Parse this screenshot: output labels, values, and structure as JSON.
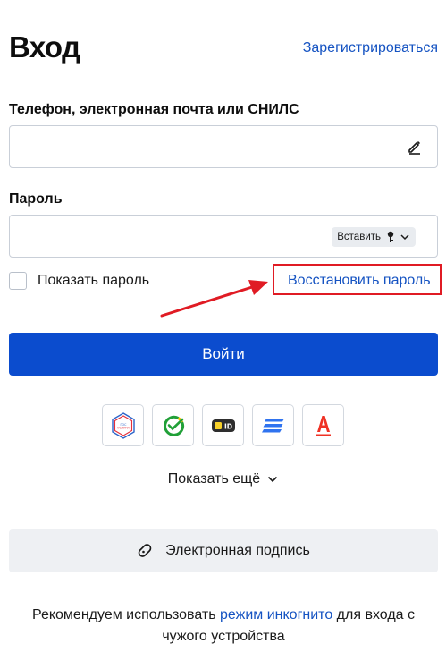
{
  "header": {
    "title": "Вход",
    "register_link": "Зарегистрироваться"
  },
  "login_field": {
    "label": "Телефон, электронная почта или СНИЛС",
    "value": "",
    "placeholder": "",
    "icon": "pencil-icon"
  },
  "password_field": {
    "label": "Пароль",
    "value": "",
    "placeholder": "",
    "paste_label": "Вставить",
    "paste_icons": [
      "key-icon",
      "chevron-down-icon"
    ]
  },
  "show_password": {
    "label": "Показать пароль",
    "checked": false
  },
  "restore_link": "Восстановить пароль",
  "annotation": {
    "highlight_color": "#e01b24",
    "arrow_color": "#e01b24"
  },
  "login_button": "Войти",
  "providers": [
    {
      "name": "gosuslugi",
      "icon": "gosuslugi-icon"
    },
    {
      "name": "sber",
      "icon": "sber-icon"
    },
    {
      "name": "id",
      "icon": "id-icon"
    },
    {
      "name": "vtb",
      "icon": "vtb-icon"
    },
    {
      "name": "alfa",
      "icon": "alfa-icon"
    }
  ],
  "show_more": "Показать ещё",
  "esign_button": "Электронная подпись",
  "recommend": {
    "before": "Рекомендуем использовать ",
    "link": "режим инкогнито",
    "after": " для входа с чужого устройства"
  },
  "colors": {
    "primary": "#0b4cce",
    "link": "#1553c2",
    "border": "#c9cfd8"
  }
}
